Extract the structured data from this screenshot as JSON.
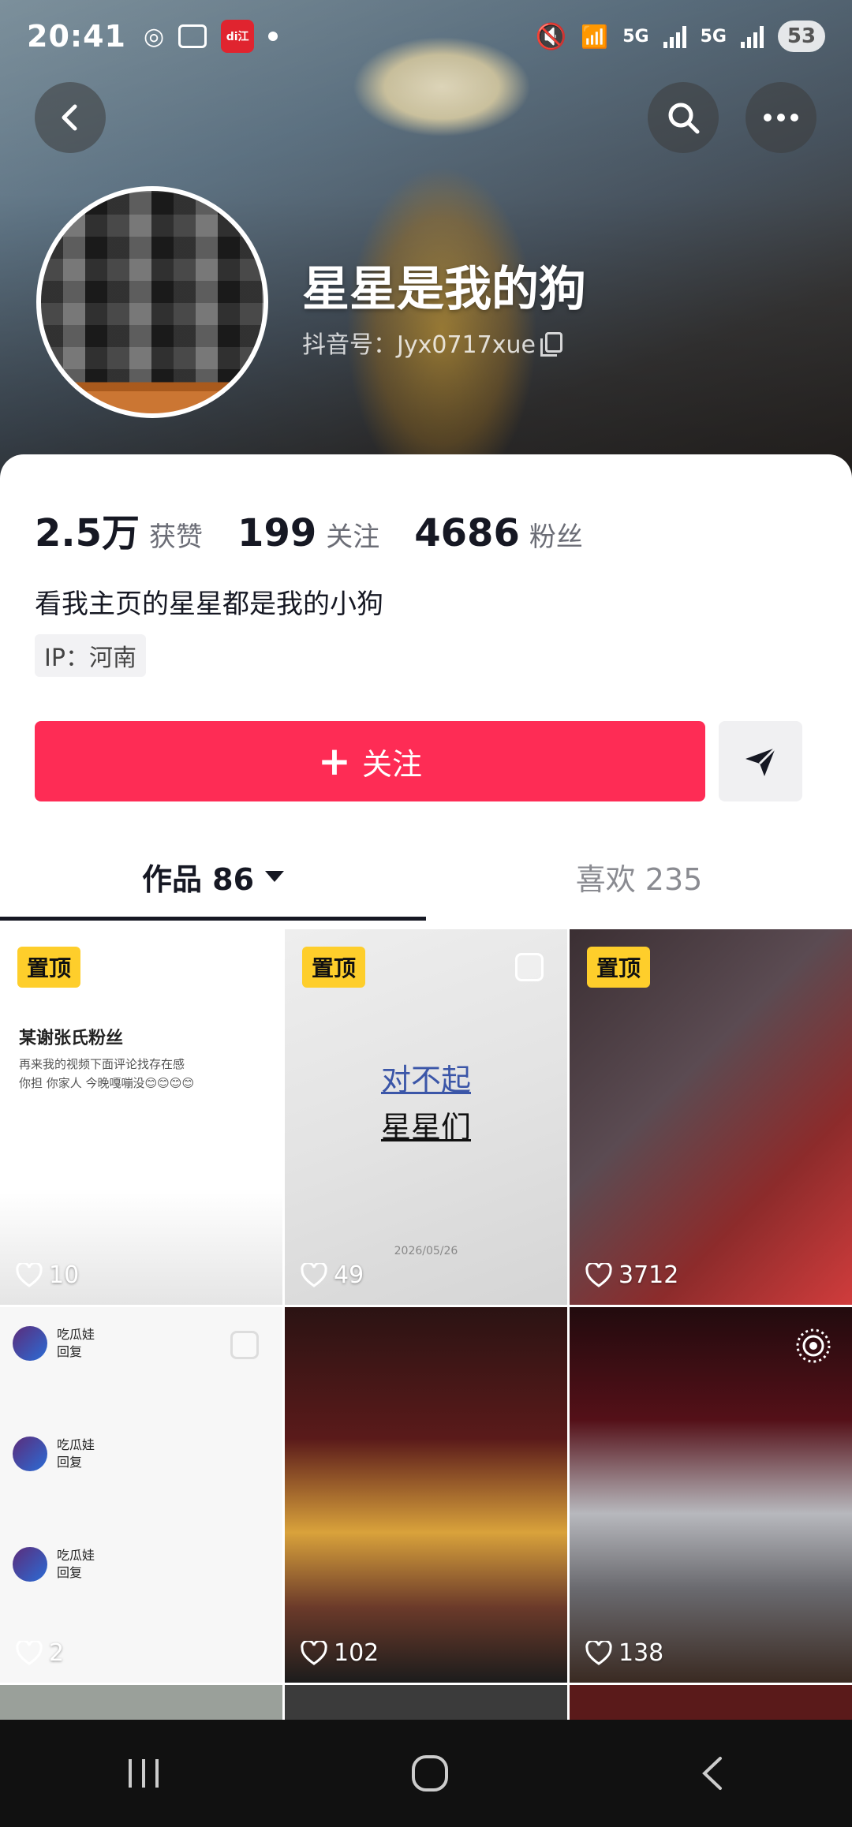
{
  "status_bar": {
    "time": "20:41",
    "app_badge": "di江",
    "network_label": "5G",
    "battery": "53"
  },
  "profile": {
    "name": "星星是我的狗",
    "id": "抖音号：Jyx0717xue",
    "bio": "看我主页的星星都是我的小狗",
    "ip": "IP：河南"
  },
  "stats": [
    {
      "value": "2.5万",
      "label": "获赞"
    },
    {
      "value": "199",
      "label": "关注"
    },
    {
      "value": "4686",
      "label": "粉丝"
    }
  ],
  "actions": {
    "follow_label": "关注"
  },
  "tabs": [
    {
      "label": "作品 86"
    },
    {
      "label": "喜欢 235"
    }
  ],
  "posts": [
    {
      "pinned": "置顶",
      "likes": "10",
      "title": "某谢张氏粉丝",
      "lines": [
        "再来我的视频下面评论找存在感",
        "你担 你家人 今晚嘎嘣没😊😊😊😊"
      ]
    },
    {
      "pinned": "置顶",
      "likes": "49",
      "text_top": "对不起",
      "text_bottom": "星星们",
      "date": "2026/05/26"
    },
    {
      "pinned": "置顶",
      "likes": "3712"
    },
    {
      "likes": "2",
      "comment_name": "吃瓜娃",
      "comment_reply": "回复"
    },
    {
      "likes": "102"
    },
    {
      "likes": "138"
    }
  ],
  "icons": {
    "back": "chevron-left-icon",
    "search": "search-icon",
    "more": "more-icon",
    "send": "send-icon",
    "heart": "heart-icon"
  },
  "colors": {
    "follow": "#fe2c55",
    "pin": "#fece2b"
  }
}
